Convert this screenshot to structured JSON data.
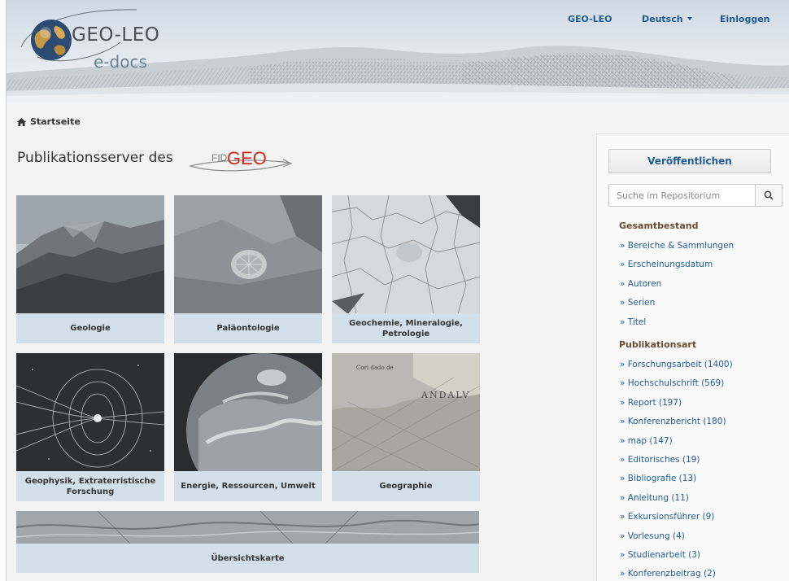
{
  "header": {
    "logo_title": "GEO-LEO",
    "logo_subtitle": "e-docs",
    "nav": {
      "geo_leo": "GEO-LEO",
      "language": "Deutsch",
      "login": "Einloggen"
    }
  },
  "breadcrumb": {
    "home_label": "Startseite",
    "icon": "home-icon"
  },
  "main": {
    "title": "Publikationsserver des",
    "partner_logo_small": "FID",
    "partner_logo_big": "GEO",
    "tiles": [
      {
        "label": "Geologie",
        "image": "mountain-photo"
      },
      {
        "label": "Paläontologie",
        "image": "fossil-photo"
      },
      {
        "label": "Geochemie, Mineralogie, Petrologie",
        "image": "mineral-micrograph"
      },
      {
        "label": "Geophysik, Extraterristische Forschung",
        "image": "magnetosphere-illustration"
      },
      {
        "label": "Energie, Ressourcen, Umwelt",
        "image": "earth-photo"
      },
      {
        "label": "Geographie",
        "image": "historic-map"
      }
    ],
    "overview_tile": {
      "label": "Übersichtskarte",
      "image": "topographic-map"
    }
  },
  "sidebar": {
    "publish_button": "Veröffentlichen",
    "search_placeholder": "Suche im Repositorium",
    "sections": [
      {
        "heading": "Gesamtbestand",
        "items": [
          "» Bereiche & Sammlungen",
          "» Erscheinungsdatum",
          "» Autoren",
          "» Serien",
          "» Titel"
        ]
      },
      {
        "heading": "Publikationsart",
        "items": [
          "» Forschungsarbeit (1400)",
          "» Hochschulschrift (569)",
          "» Report (197)",
          "» Konferenzbericht (180)",
          "» map (147)",
          "» Editorisches (19)",
          "» Bibliografie (13)",
          "» Anleitung (11)",
          "» Exkursionsführer (9)",
          "» Vorlesung (4)",
          "» Studienarbeit (3)",
          "» Konferenzbeitrag (2)"
        ]
      }
    ]
  },
  "colors": {
    "link": "#1f5c96",
    "heading_brown": "#6b4a2d",
    "caption_bg": "#d3dfe9",
    "fid_red": "#d42a1e"
  }
}
